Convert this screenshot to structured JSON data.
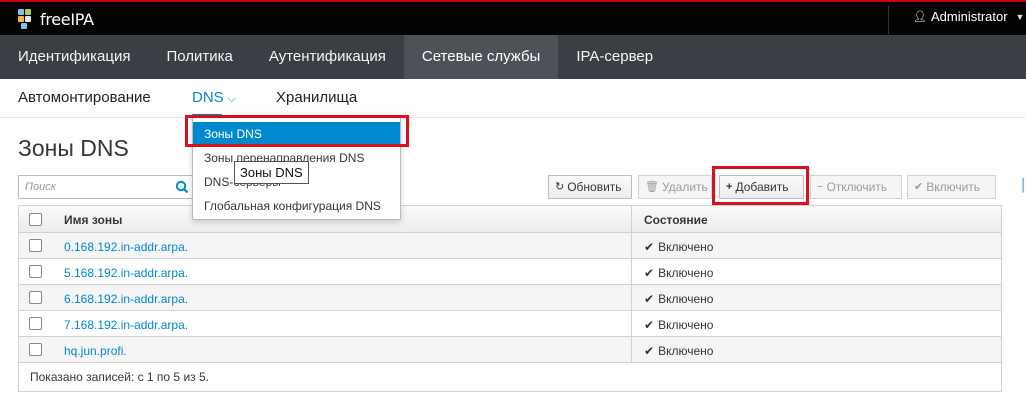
{
  "header": {
    "brand": "freeIPA",
    "user": "Administrator",
    "colors": {
      "bar": "#030303",
      "accent": "#c00000"
    }
  },
  "primary_nav": [
    {
      "label": "Идентификация"
    },
    {
      "label": "Политика"
    },
    {
      "label": "Аутентификация"
    },
    {
      "label": "Сетевые службы",
      "active": true
    },
    {
      "label": "IPA-сервер"
    }
  ],
  "secondary_nav": {
    "automount": "Автомонтирование",
    "dns": "DNS",
    "vaults": "Хранилища"
  },
  "page_title": "Зоны DNS",
  "search": {
    "placeholder": "Поиск",
    "icon": "search-icon"
  },
  "toolbar": {
    "refresh": "Обновить",
    "delete": "Удалить",
    "add": "Добавить",
    "disable": "Отключить",
    "enable": "Включить"
  },
  "table": {
    "columns": [
      "Имя зоны",
      "Состояние"
    ],
    "rows": [
      {
        "name": "0.168.192.in-addr.arpa.",
        "state": "Включено"
      },
      {
        "name": "5.168.192.in-addr.arpa.",
        "state": "Включено"
      },
      {
        "name": "6.168.192.in-addr.arpa.",
        "state": "Включено"
      },
      {
        "name": "7.168.192.in-addr.arpa.",
        "state": "Включено"
      },
      {
        "name": "hq.jun.profi.",
        "state": "Включено"
      }
    ],
    "footer": "Показано записей: с 1 по 5 из 5."
  },
  "dns_dropdown": {
    "items": [
      {
        "label": "Зоны DNS",
        "selected": true
      },
      {
        "label": "Зоны перенаправления DNS"
      },
      {
        "label": "DNS-серверы"
      },
      {
        "label": "Глобальная конфигурация DNS"
      }
    ]
  },
  "tooltip": "Зоны DNS",
  "colors": {
    "link": "#0088ce",
    "highlight": "#d8111c",
    "nav": "#393f44"
  }
}
